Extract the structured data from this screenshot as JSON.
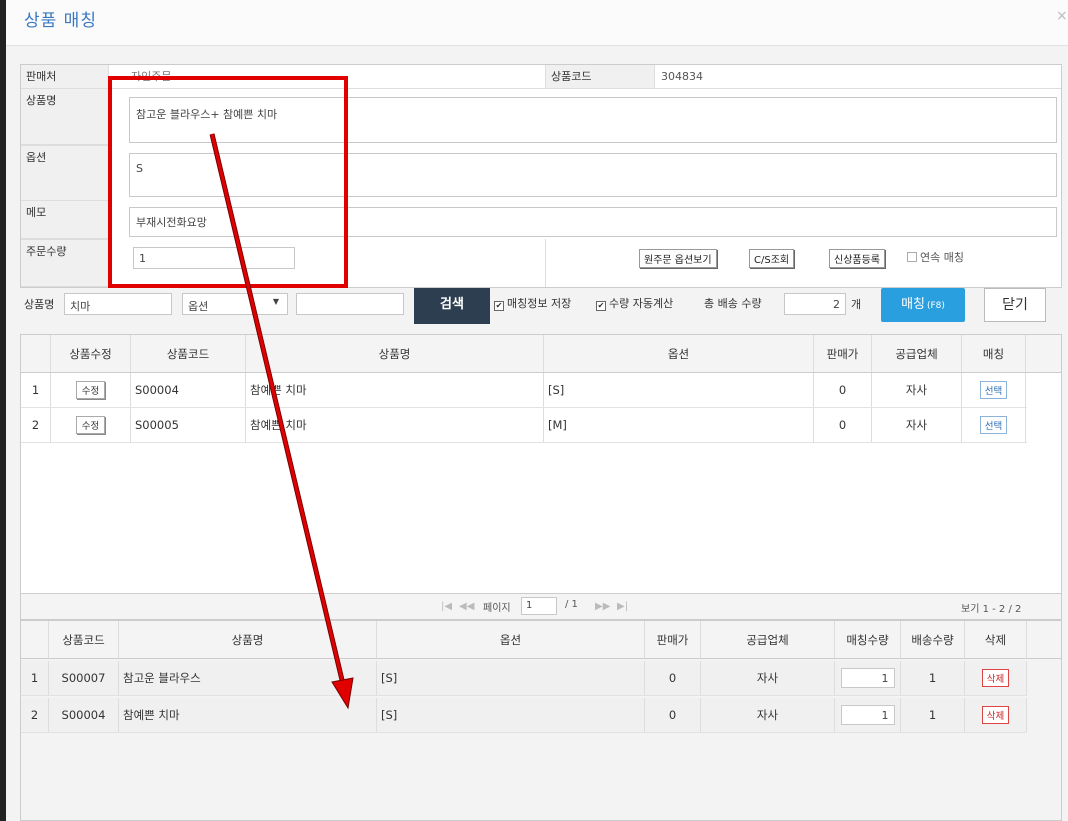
{
  "dialog": {
    "title": "상품 매칭",
    "close_glyph": "×"
  },
  "form": {
    "seller_label": "판매처",
    "seller_value": "자인주문",
    "product_code_label": "상품코드",
    "product_code_value": "304834",
    "product_name_label": "상품명",
    "product_name_value": "참고운 블라우스+ 참예쁜 치마",
    "option_label": "옵션",
    "option_value": "S",
    "memo_label": "메모",
    "memo_value": "부재시전화요망",
    "qty_label": "주문수량",
    "qty_value": "1",
    "btn_option_view": "원주문 옵션보기",
    "btn_cs": "C/S조회",
    "btn_new_product": "신상품등록",
    "continuous_label": "연속 매칭"
  },
  "search": {
    "name_label": "상품명",
    "name_value": "치마",
    "option_select": "옵션",
    "search_button": "검색",
    "save_match_label": "매칭정보 저장",
    "auto_qty_label": "수량 자동계산",
    "total_qty_label": "총 배송 수량",
    "total_qty_value": "2",
    "unit": "개",
    "match_button": "매칭",
    "match_shortcut": "(F8)",
    "close_button": "닫기"
  },
  "top_grid": {
    "headers": [
      "상품수정",
      "상품코드",
      "상품명",
      "옵션",
      "판매가",
      "공급업체",
      "매칭"
    ],
    "rows": [
      {
        "no": "1",
        "edit": "수정",
        "code": "S00004",
        "name": "참예쁜 치마",
        "option": "[S]",
        "price": "0",
        "supplier": "자사",
        "select": "선택"
      },
      {
        "no": "2",
        "edit": "수정",
        "code": "S00005",
        "name": "참예쁜 치마",
        "option": "[M]",
        "price": "0",
        "supplier": "자사",
        "select": "선택"
      }
    ],
    "pager": {
      "first": "|◀",
      "prev": "◀◀",
      "page_label": "페이지",
      "page_value": "1",
      "total": "/ 1",
      "next": "▶▶",
      "last": "▶|",
      "summary": "보기 1 - 2 / 2"
    }
  },
  "bottom_grid": {
    "headers": [
      "상품코드",
      "상품명",
      "옵션",
      "판매가",
      "공급업체",
      "매칭수량",
      "배송수량",
      "삭제"
    ],
    "rows": [
      {
        "no": "1",
        "code": "S00007",
        "name": "참고운 블라우스",
        "option": "[S]",
        "price": "0",
        "supplier": "자사",
        "match_qty": "1",
        "ship_qty": "1",
        "delete": "삭제"
      },
      {
        "no": "2",
        "code": "S00004",
        "name": "참예쁜 치마",
        "option": "[S]",
        "price": "0",
        "supplier": "자사",
        "match_qty": "1",
        "ship_qty": "1",
        "delete": "삭제"
      }
    ]
  },
  "colors": {
    "annotation_red": "#e00000",
    "title_blue": "#3a78c2",
    "match_blue": "#2a9fe0",
    "search_dark": "#2c3e50"
  }
}
